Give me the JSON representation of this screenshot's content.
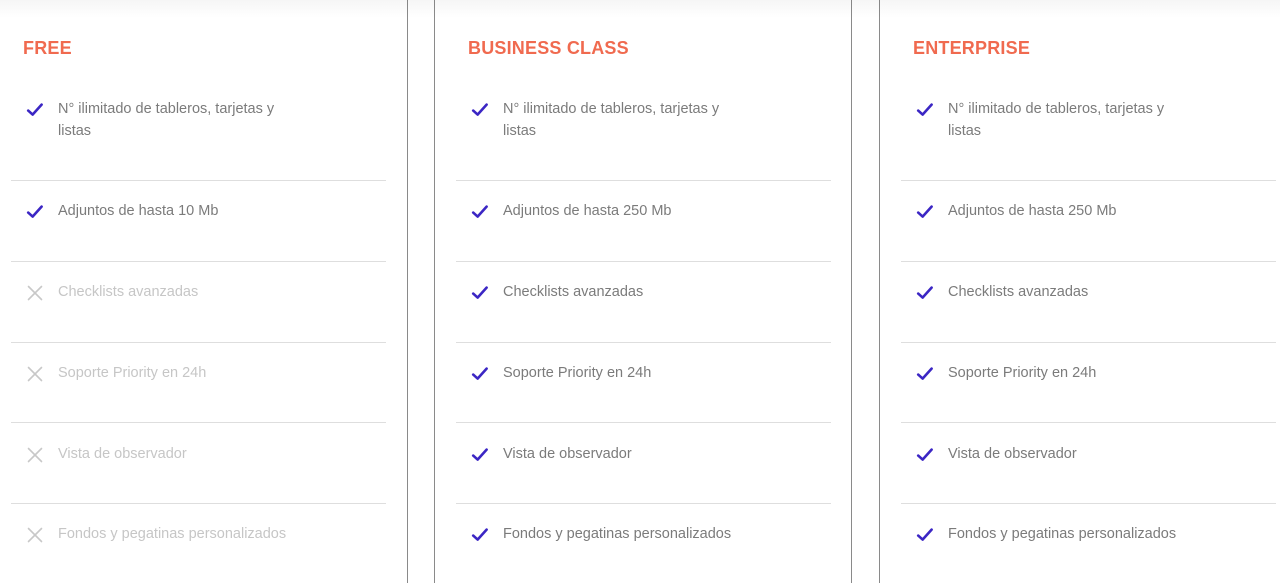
{
  "colors": {
    "accent_title": "#f06a4f",
    "check": "#3b26c4",
    "cross": "#c8c8c8",
    "text": "#7b7b7b",
    "text_disabled": "#c6c6c6"
  },
  "icons": {
    "included": "check-icon",
    "excluded": "cross-icon"
  },
  "plans": [
    {
      "name": "FREE",
      "features": [
        {
          "label": "N° ilimitado de tableros, tarjetas y listas",
          "included": true
        },
        {
          "label": "Adjuntos de hasta 10 Mb",
          "included": true
        },
        {
          "label": "Checklists avanzadas",
          "included": false
        },
        {
          "label": "Soporte Priority en 24h",
          "included": false
        },
        {
          "label": "Vista de observador",
          "included": false
        },
        {
          "label": "Fondos y pegatinas personalizados",
          "included": false
        }
      ]
    },
    {
      "name": "BUSINESS CLASS",
      "features": [
        {
          "label": "N° ilimitado de tableros, tarjetas y listas",
          "included": true
        },
        {
          "label": "Adjuntos de hasta 250 Mb",
          "included": true
        },
        {
          "label": "Checklists avanzadas",
          "included": true
        },
        {
          "label": "Soporte Priority en 24h",
          "included": true
        },
        {
          "label": "Vista de observador",
          "included": true
        },
        {
          "label": "Fondos y pegatinas personalizados",
          "included": true
        }
      ]
    },
    {
      "name": "ENTERPRISE",
      "features": [
        {
          "label": "N° ilimitado de tableros, tarjetas y listas",
          "included": true
        },
        {
          "label": "Adjuntos de hasta 250 Mb",
          "included": true
        },
        {
          "label": "Checklists avanzadas",
          "included": true
        },
        {
          "label": "Soporte Priority en 24h",
          "included": true
        },
        {
          "label": "Vista de observador",
          "included": true
        },
        {
          "label": "Fondos y pegatinas personalizados",
          "included": true
        }
      ]
    }
  ]
}
